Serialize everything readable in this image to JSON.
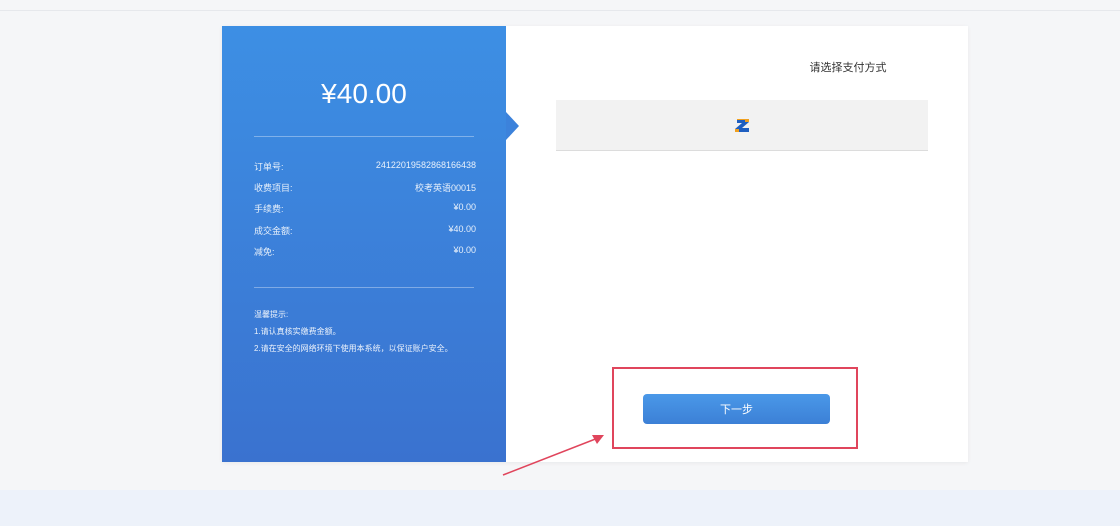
{
  "order": {
    "amount": "¥40.00",
    "rows": [
      {
        "label": "订单号:",
        "value": "24122019582868166438"
      },
      {
        "label": "收费项目:",
        "value": "校考英语00015"
      },
      {
        "label": "手续费:",
        "value": "¥0.00"
      },
      {
        "label": "成交金额:",
        "value": "¥40.00"
      },
      {
        "label": "减免:",
        "value": "¥0.00"
      }
    ],
    "tips_title": "温馨提示:",
    "tips": [
      "1.请认真核实缴费金额。",
      "2.请在安全的网络环境下使用本系统，以保证账户安全。"
    ]
  },
  "payment": {
    "title": "请选择支付方式",
    "method_icon": "z-pay-logo-icon",
    "next_label": "下一步"
  },
  "colors": {
    "panel_gradient_top": "#3d8fe4",
    "panel_gradient_bottom": "#3a72cf",
    "highlight": "#e0455c",
    "button": "#4a90e2"
  }
}
